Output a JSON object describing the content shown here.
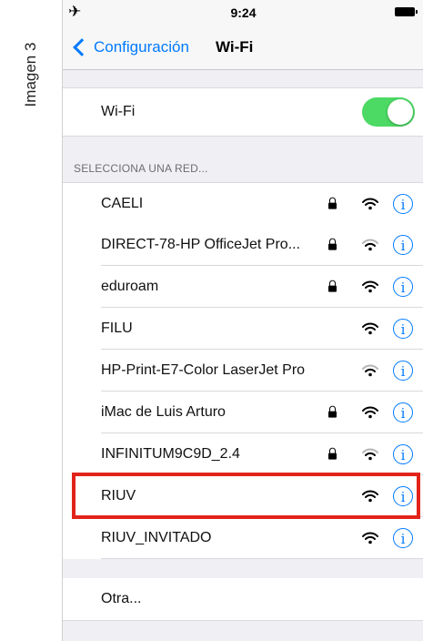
{
  "side_label": "Imagen 3",
  "status_bar": {
    "time": "9:24"
  },
  "nav": {
    "back_label": "Configuración",
    "title": "Wi-Fi"
  },
  "wifi_toggle": {
    "label": "Wi-Fi",
    "on": true
  },
  "section_header": "SELECCIONA UNA RED...",
  "networks": [
    {
      "name": "CAELI",
      "locked": true,
      "signal": "full"
    },
    {
      "name": "DIRECT-78-HP OfficeJet Pro...",
      "locked": true,
      "signal": "partial"
    },
    {
      "name": "eduroam",
      "locked": true,
      "signal": "full"
    },
    {
      "name": "FILU",
      "locked": false,
      "signal": "full"
    },
    {
      "name": "HP-Print-E7-Color LaserJet Pro",
      "locked": false,
      "signal": "partial"
    },
    {
      "name": "iMac de Luis Arturo",
      "locked": true,
      "signal": "full"
    },
    {
      "name": "INFINITUM9C9D_2.4",
      "locked": true,
      "signal": "partial"
    },
    {
      "name": "RIUV",
      "locked": false,
      "signal": "full",
      "highlighted": true
    },
    {
      "name": "RIUV_INVITADO",
      "locked": false,
      "signal": "full"
    }
  ],
  "other_label": "Otra...",
  "colors": {
    "accent": "#007aff",
    "toggle_on": "#4cd964",
    "highlight": "#e2231a",
    "background": "#efeff4"
  }
}
